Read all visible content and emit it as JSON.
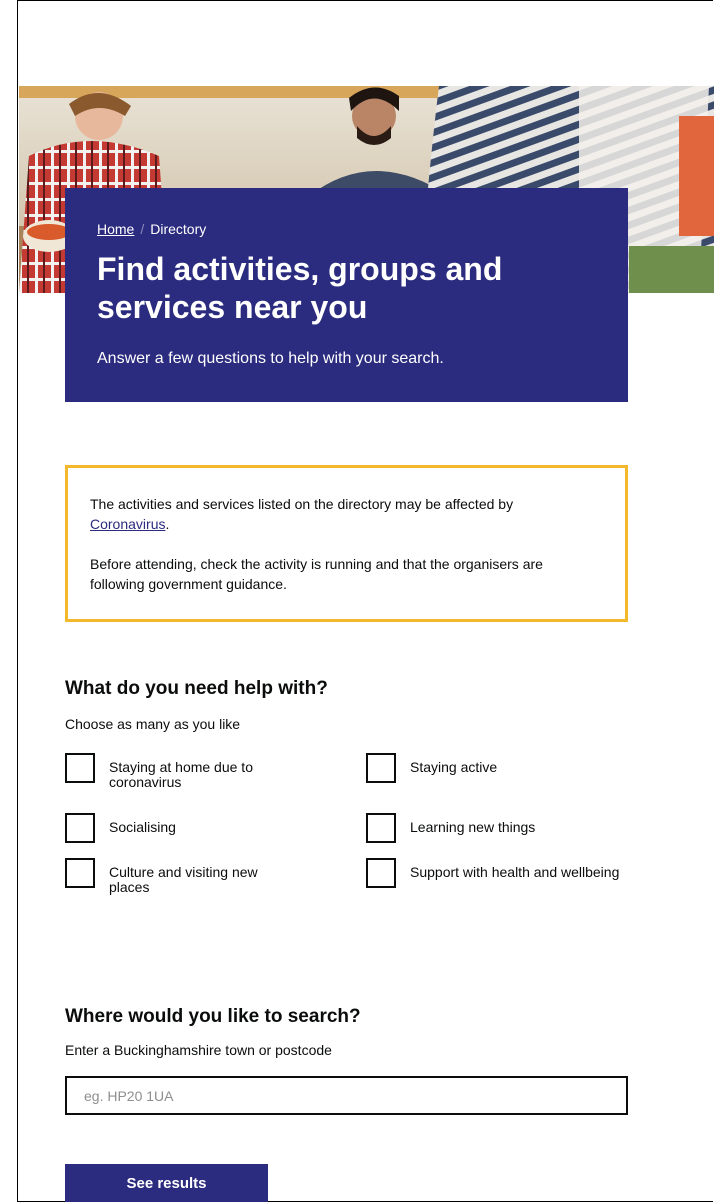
{
  "breadcrumb": {
    "home": "Home",
    "separator": "/",
    "current": "Directory"
  },
  "hero": {
    "title": "Find activities, groups and services near you",
    "subtitle": "Answer a few questions to help with your search."
  },
  "notice": {
    "line1": "The activities and services listed on the directory may be affected by",
    "link": "Coronavirus",
    "line1_end": ".",
    "line2": "Before attending, check the activity is running and that the organisers are following government guidance."
  },
  "help_section": {
    "heading": "What do you need help with?",
    "hint": "Choose as many as you like",
    "options": [
      "Staying at home due to coronavirus",
      "Staying active",
      "Socialising",
      "Learning new things",
      "Culture and visiting new places",
      "Support with health and wellbeing"
    ]
  },
  "search_section": {
    "heading": "Where would you like to search?",
    "hint": "Enter a Buckinghamshire town or postcode",
    "placeholder": "eg. HP20 1UA"
  },
  "submit_label": "See results",
  "colors": {
    "brand": "#2b2b7f",
    "notice_border": "#f4b82c"
  }
}
